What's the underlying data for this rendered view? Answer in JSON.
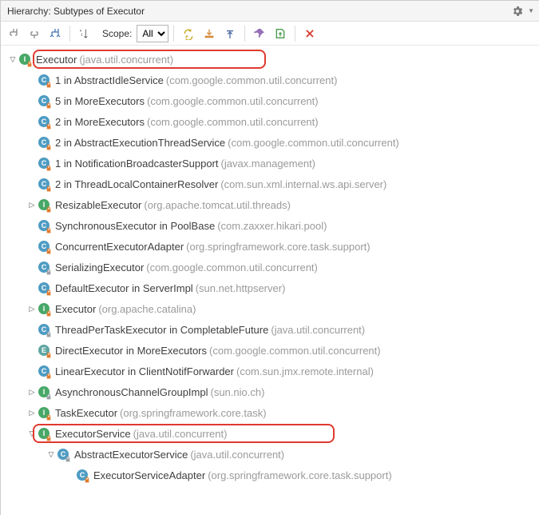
{
  "header": {
    "title": "Hierarchy: Subtypes of Executor"
  },
  "toolbar": {
    "scope_label": "Scope:",
    "scope_value": "All"
  },
  "icons": {
    "interface_letter": "I",
    "class_letter": "C",
    "enum_letter": "E"
  },
  "tree": [
    {
      "depth": 0,
      "arrow": "down",
      "icon": "interface",
      "lock": "orange",
      "name": "Executor",
      "pkg": "(java.util.concurrent)",
      "hl": 1
    },
    {
      "depth": 1,
      "arrow": "",
      "icon": "class",
      "lock": "orange",
      "name": "1 in AbstractIdleService",
      "pkg": "(com.google.common.util.concurrent)"
    },
    {
      "depth": 1,
      "arrow": "",
      "icon": "class",
      "lock": "orange",
      "name": "5 in MoreExecutors",
      "pkg": "(com.google.common.util.concurrent)"
    },
    {
      "depth": 1,
      "arrow": "",
      "icon": "class",
      "lock": "orange",
      "name": "2 in MoreExecutors",
      "pkg": "(com.google.common.util.concurrent)"
    },
    {
      "depth": 1,
      "arrow": "",
      "icon": "class",
      "lock": "orange",
      "name": "2 in AbstractExecutionThreadService",
      "pkg": "(com.google.common.util.concurrent)"
    },
    {
      "depth": 1,
      "arrow": "",
      "icon": "class",
      "lock": "orange",
      "name": "1 in NotificationBroadcasterSupport",
      "pkg": "(javax.management)"
    },
    {
      "depth": 1,
      "arrow": "",
      "icon": "class",
      "lock": "orange",
      "name": "2 in ThreadLocalContainerResolver",
      "pkg": "(com.sun.xml.internal.ws.api.server)"
    },
    {
      "depth": 1,
      "arrow": "right",
      "icon": "interface",
      "lock": "orange",
      "name": "ResizableExecutor",
      "pkg": "(org.apache.tomcat.util.threads)"
    },
    {
      "depth": 1,
      "arrow": "",
      "icon": "class",
      "lock": "orange",
      "name": "SynchronousExecutor in PoolBase",
      "pkg": "(com.zaxxer.hikari.pool)"
    },
    {
      "depth": 1,
      "arrow": "",
      "icon": "class",
      "lock": "orange",
      "name": "ConcurrentExecutorAdapter",
      "pkg": "(org.springframework.core.task.support)"
    },
    {
      "depth": 1,
      "arrow": "",
      "icon": "class",
      "lock": "gray",
      "name": "SerializingExecutor",
      "pkg": "(com.google.common.util.concurrent)"
    },
    {
      "depth": 1,
      "arrow": "",
      "icon": "class",
      "lock": "orange",
      "name": "DefaultExecutor in ServerImpl",
      "pkg": "(sun.net.httpserver)"
    },
    {
      "depth": 1,
      "arrow": "right",
      "icon": "interface",
      "lock": "orange",
      "name": "Executor",
      "pkg": "(org.apache.catalina)"
    },
    {
      "depth": 1,
      "arrow": "",
      "icon": "class",
      "lock": "gray",
      "name": "ThreadPerTaskExecutor in CompletableFuture",
      "pkg": "(java.util.concurrent)"
    },
    {
      "depth": 1,
      "arrow": "",
      "icon": "enum",
      "lock": "orange",
      "name": "DirectExecutor in MoreExecutors",
      "pkg": "(com.google.common.util.concurrent)"
    },
    {
      "depth": 1,
      "arrow": "",
      "icon": "class",
      "lock": "orange",
      "name": "LinearExecutor in ClientNotifForwarder",
      "pkg": "(com.sun.jmx.remote.internal)"
    },
    {
      "depth": 1,
      "arrow": "right",
      "icon": "interface",
      "lock": "gray",
      "name": "AsynchronousChannelGroupImpl",
      "pkg": "(sun.nio.ch)"
    },
    {
      "depth": 1,
      "arrow": "right",
      "icon": "interface",
      "lock": "orange",
      "name": "TaskExecutor",
      "pkg": "(org.springframework.core.task)"
    },
    {
      "depth": 1,
      "arrow": "down",
      "icon": "interface",
      "lock": "orange",
      "name": "ExecutorService",
      "pkg": "(java.util.concurrent)",
      "hl": 2
    },
    {
      "depth": 2,
      "arrow": "down",
      "icon": "class",
      "lock": "gray",
      "name": "AbstractExecutorService",
      "pkg": "(java.util.concurrent)"
    },
    {
      "depth": 3,
      "arrow": "",
      "icon": "class",
      "lock": "orange",
      "name": "ExecutorServiceAdapter",
      "pkg": "(org.springframework.core.task.support)"
    }
  ]
}
